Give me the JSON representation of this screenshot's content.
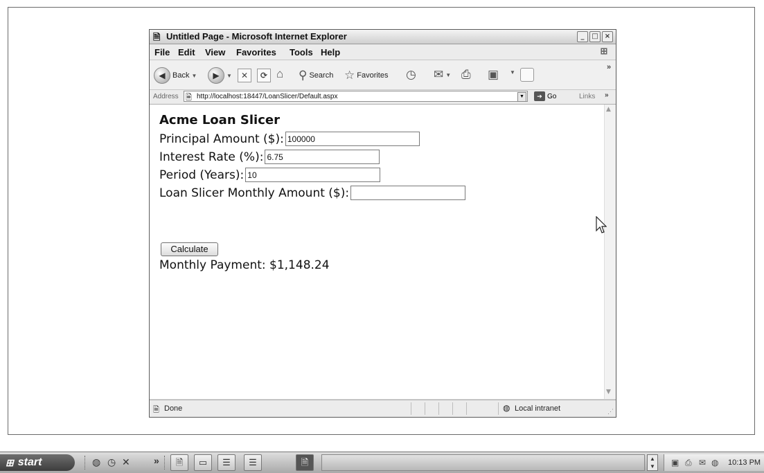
{
  "window": {
    "title": "Untitled Page - Microsoft Internet Explorer",
    "controls": {
      "minimize": "_",
      "maximize": "□",
      "close": "×"
    }
  },
  "menu": [
    "File",
    "Edit",
    "View",
    "Favorites",
    "Tools",
    "Help"
  ],
  "toolbar": {
    "back_label": "Back",
    "search_label": "Search",
    "favorites_label": "Favorites",
    "overflow": "»"
  },
  "address": {
    "label": "Address",
    "url": "http://localhost:18447/LoanSlicer/Default.aspx",
    "go_label": "Go",
    "links_label": "Links",
    "links_overflow": "»"
  },
  "page": {
    "title": "Acme Loan Slicer",
    "fields": [
      {
        "label": "Principal Amount ($):",
        "value": "100000"
      },
      {
        "label": "Interest Rate (%):",
        "value": "6.75"
      },
      {
        "label": "Period (Years):",
        "value": "10"
      },
      {
        "label": "Loan Slicer Monthly Amount ($):",
        "value": ""
      }
    ],
    "calculate_label": "Calculate",
    "result": "Monthly Payment: $1,148.24"
  },
  "status": {
    "text": "Done",
    "zone": "Local intranet"
  },
  "taskbar": {
    "start_label": "start",
    "quicklaunch_overflow": "»",
    "clock": "10:13 PM"
  },
  "icons": {
    "ie_page": "🗎",
    "back": "◀",
    "forward": "▶",
    "stop": "✕",
    "refresh": "⟳",
    "home": "⌂",
    "search": "⚲",
    "favorites": "☆",
    "history": "◷",
    "mail": "✉",
    "print": "⎙",
    "edit": "▣",
    "windows_flag": "⊞",
    "globe": "◍",
    "go": "➔"
  }
}
